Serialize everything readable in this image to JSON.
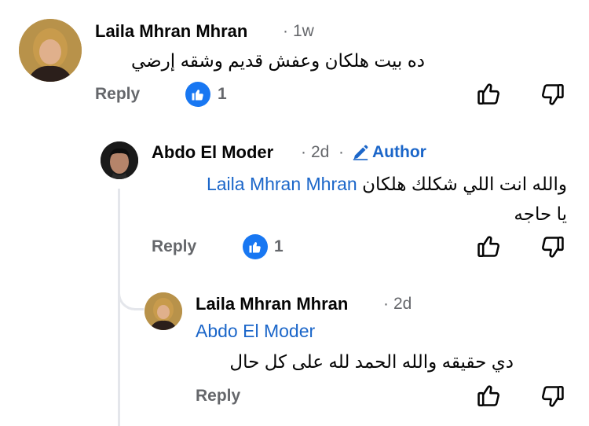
{
  "comments": [
    {
      "name": "Laila Mhran Mhran",
      "time": "1w",
      "text": "ده بيت هلكان وعفش قديم وشقه إرضي",
      "reply_label": "Reply",
      "like_count": "1"
    },
    {
      "name": "Abdo El Moder",
      "time": "2d",
      "badge": "Author",
      "mention": "Laila Mhran Mhran",
      "text_line1": "والله انت اللي شكلك هلكان",
      "text_line2": "يا حاجه",
      "reply_label": "Reply",
      "like_count": "1"
    },
    {
      "name": "Laila Mhran Mhran",
      "time": "2d",
      "mention": "Abdo El Moder",
      "text": "دي حقيقه والله الحمد لله على كل حال",
      "reply_label": "Reply"
    }
  ],
  "separator": "·",
  "icons": {
    "like": "thumbs-up-icon",
    "dislike": "thumbs-down-icon",
    "author": "pencil-icon",
    "like_badge": "like-badge-icon"
  },
  "colors": {
    "link": "#1b66c9",
    "meta": "#65676b",
    "like_badge": "#1877f2"
  }
}
